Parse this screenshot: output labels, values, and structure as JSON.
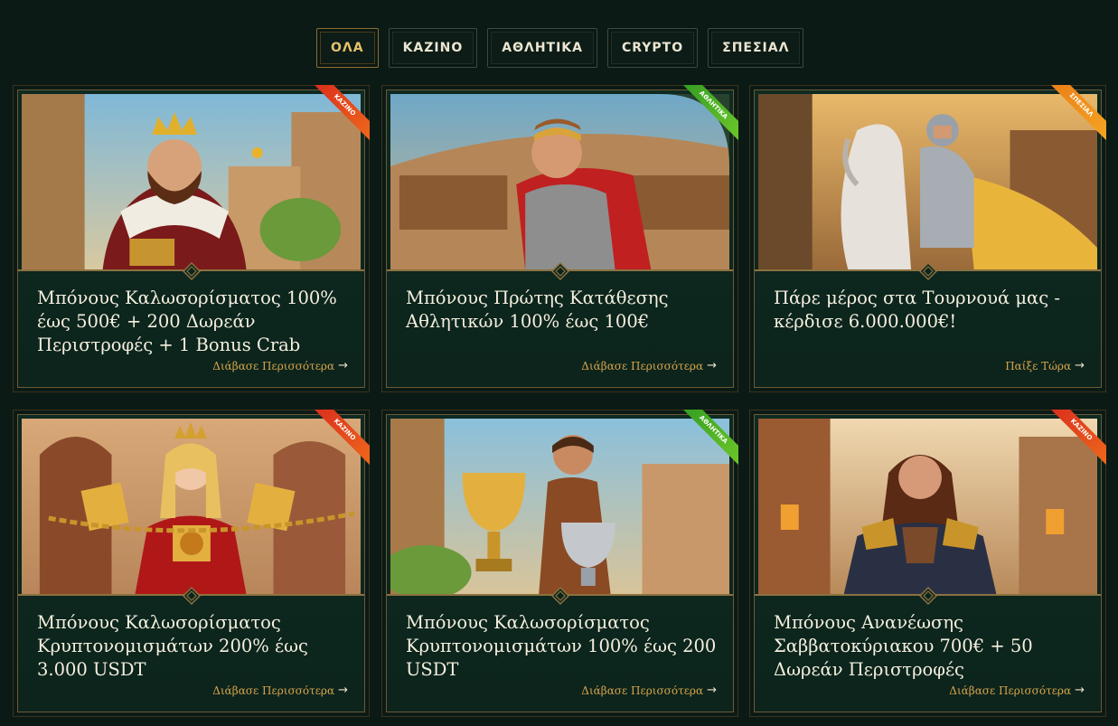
{
  "tabs": [
    {
      "label": "ΟΛΑ",
      "active": true
    },
    {
      "label": "ΚΑΖΙΝΟ",
      "active": false
    },
    {
      "label": "ΑΘΛΗΤΙΚΑ",
      "active": false
    },
    {
      "label": "CRYPTO",
      "active": false
    },
    {
      "label": "ΣΠΕΣΙΑΛ",
      "active": false
    }
  ],
  "cards": [
    {
      "ribbon": "ΚΑΖΙΝΟ",
      "ribbon_color": "red",
      "title": "Μπόνους Καλωσορίσματος 100% έως 500€ + 200 Δωρεάν Περιστροφές + 1 Bonus Crab",
      "link": "Διάβασε Περισσότερα",
      "image": "king"
    },
    {
      "ribbon": "ΑΘΛΗΤΙΚΑ",
      "ribbon_color": "green",
      "title": "Μπόνους Πρώτης Κατάθεσης Αθλητικών 100% έως 100€",
      "link": "Διάβασε Περισσότερα",
      "image": "gladiator"
    },
    {
      "ribbon": "ΣΠΕΣΙΑΛ",
      "ribbon_color": "orange",
      "title": "Πάρε μέρος στα Τουρνουά μας - κέρδισε 6.000.000€!",
      "link": "Παίξε Τώρα",
      "image": "knight"
    },
    {
      "ribbon": "ΚΑΖΙΝΟ",
      "ribbon_color": "red",
      "title": "Μπόνους Καλωσορίσματος Κρυπτονομισμάτων 200% έως 3.000 USDT",
      "link": "Διάβασε Περισσότερα",
      "image": "queen"
    },
    {
      "ribbon": "ΑΘΛΗΤΙΚΑ",
      "ribbon_color": "green",
      "title": "Μπόνους Καλωσορίσματος Κρυπτονομισμάτων 100% έως 200 USDT",
      "link": "Διάβασε Περισσότερα",
      "image": "trophy"
    },
    {
      "ribbon": "ΚΑΖΙΝΟ",
      "ribbon_color": "red",
      "title": "Μπόνους Ανανέωσης Σαββατοκύριακου 700€ + 50 Δωρεάν Περιστροφές",
      "link": "Διάβασε Περισσότερα",
      "image": "woman"
    }
  ]
}
